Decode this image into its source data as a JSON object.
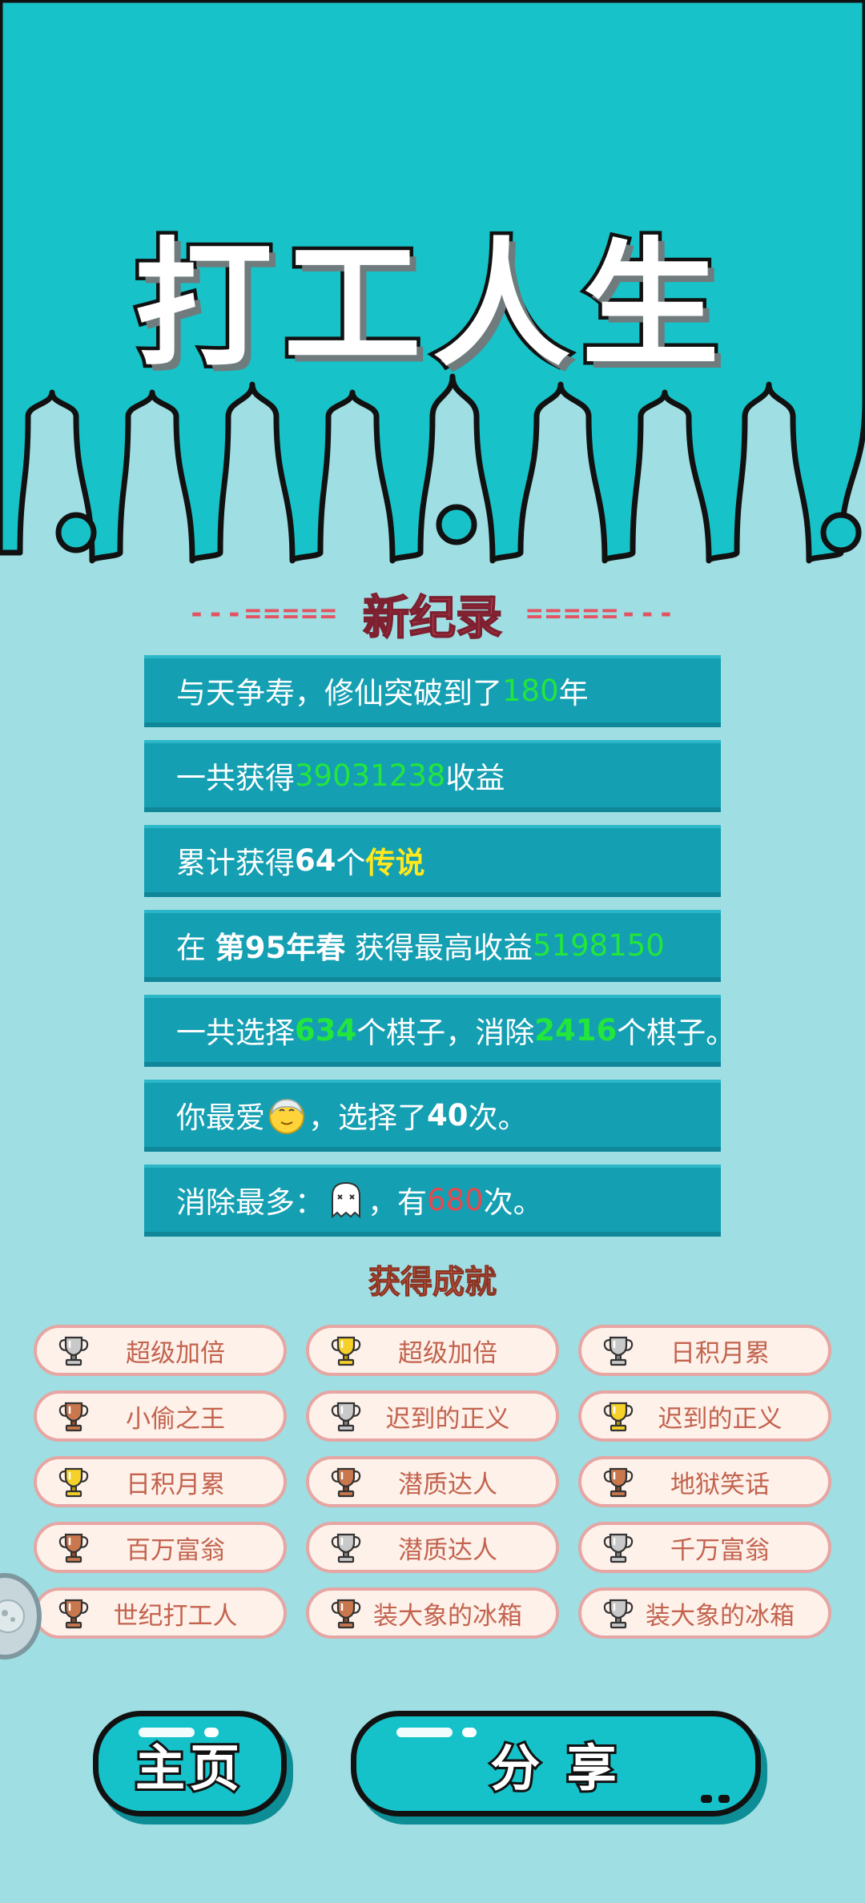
{
  "title": "打工人生",
  "record": {
    "deco_left": "---=====",
    "title": "新纪录",
    "deco_right": "=====---"
  },
  "stats": {
    "s1": {
      "a": "与天争寿，修仙突破到了",
      "v": "180",
      "b": "年"
    },
    "s2": {
      "a": "一共获得",
      "v": "39031238",
      "b": "收益"
    },
    "s3": {
      "a": "累计获得",
      "v": "64",
      "b": "个",
      "c": "传说"
    },
    "s4": {
      "a": "在 ",
      "v": "第95年春",
      "b": " 获得最高收益",
      "c": "5198150"
    },
    "s5": {
      "a": "一共选择",
      "v": "634",
      "b": "个棋子，消除",
      "c": "2416",
      "d": "个棋子。"
    },
    "s6": {
      "a": "你最爱",
      "b": "，选择了",
      "v": "40",
      "c": "次。",
      "icon": "old-man-emoji-icon"
    },
    "s7": {
      "a": "消除最多：",
      "b": "，有",
      "v": "680",
      "c": "次。",
      "icon": "ghost-icon"
    }
  },
  "achievements_title": "获得成就",
  "achievements": [
    {
      "label": "超级加倍",
      "trophy": "silver"
    },
    {
      "label": "超级加倍",
      "trophy": "gold"
    },
    {
      "label": "日积月累",
      "trophy": "silver"
    },
    {
      "label": "小偷之王",
      "trophy": "bronze"
    },
    {
      "label": "迟到的正义",
      "trophy": "silver"
    },
    {
      "label": "迟到的正义",
      "trophy": "gold"
    },
    {
      "label": "日积月累",
      "trophy": "gold"
    },
    {
      "label": "潜质达人",
      "trophy": "bronze"
    },
    {
      "label": "地狱笑话",
      "trophy": "bronze"
    },
    {
      "label": "百万富翁",
      "trophy": "bronze"
    },
    {
      "label": "潜质达人",
      "trophy": "silver"
    },
    {
      "label": "千万富翁",
      "trophy": "silver"
    },
    {
      "label": "世纪打工人",
      "trophy": "bronze"
    },
    {
      "label": "装大象的冰箱",
      "trophy": "bronze"
    },
    {
      "label": "装大象的冰箱",
      "trophy": "silver"
    }
  ],
  "buttons": {
    "home": "主页",
    "share": "分 享"
  },
  "colors": {
    "top_teal": "#17c3c8",
    "page_bg": "#9fdee3",
    "stat_bg": "#159fb3",
    "highlight_green": "#22e63c",
    "legend_yellow": "#ffe81c",
    "record_red": "#e35361",
    "trophy_gold": "#f2c81a",
    "trophy_silver": "#b8b8b8",
    "trophy_bronze": "#c7744b"
  }
}
